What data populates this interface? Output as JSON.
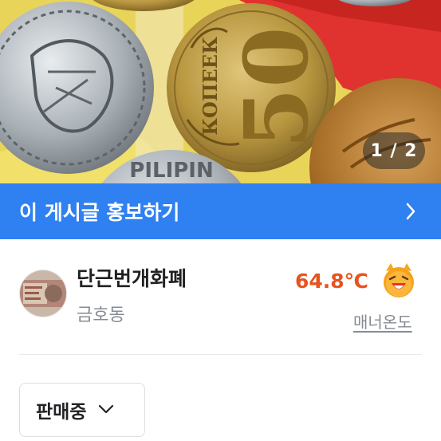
{
  "photo": {
    "alt": "coins photo",
    "coin_text_top": "КОПЕЕК",
    "coin_value": "50",
    "coin_text_bottom": "PILIPIN",
    "counter": "1 / 2"
  },
  "promo": {
    "label": "이 게시글 홍보하기",
    "icon": "chevron-right-icon",
    "bg": "#2f80f0"
  },
  "seller": {
    "name": "단근번개화폐",
    "location": "금호동",
    "manner_temp": "64.8℃",
    "manner_label": "매너온도",
    "temp_color": "#e8531f",
    "face_icon": "happy-face-icon"
  },
  "status": {
    "selected": "판매중",
    "icon": "chevron-down-icon"
  }
}
